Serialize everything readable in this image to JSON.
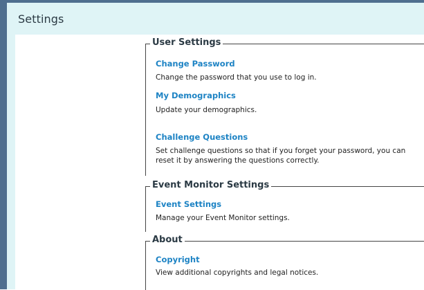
{
  "header": {
    "title": "Settings"
  },
  "sections": [
    {
      "legend": "User Settings",
      "items": [
        {
          "label": "Change Password",
          "description": "Change the password that you use to log in."
        },
        {
          "label": "My Demographics",
          "description": "Update your demographics."
        },
        {
          "label": "Challenge Questions",
          "description": "Set challenge questions so that if you forget your password, you can reset it by answering the questions correctly."
        }
      ]
    },
    {
      "legend": "Event Monitor Settings",
      "items": [
        {
          "label": "Event Settings",
          "description": "Manage your Event Monitor settings."
        }
      ]
    },
    {
      "legend": "About",
      "items": [
        {
          "label": "Copyright",
          "description": "View additional copyrights and legal notices."
        }
      ]
    }
  ],
  "colors": {
    "link": "#1d83c4",
    "header_bg": "#dff4f6",
    "window_edge": "#4f6f8f"
  }
}
